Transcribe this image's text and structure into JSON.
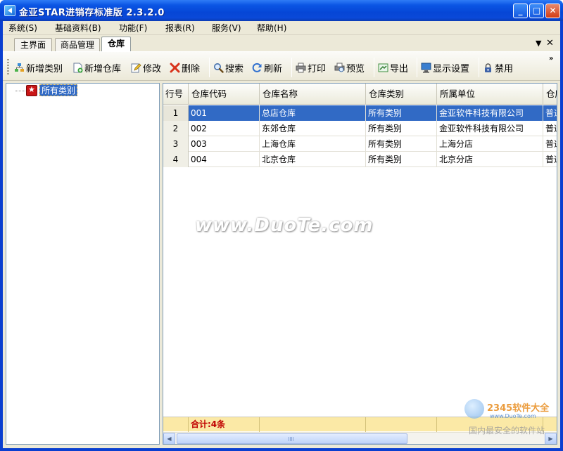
{
  "window": {
    "title": "金亚STAR进销存标准版 2.3.2.0",
    "controls": {
      "minimize": "_",
      "maximize": "□",
      "close": "✕"
    }
  },
  "menu": [
    {
      "label": "系统(S)"
    },
    {
      "label": "基础资料(B)"
    },
    {
      "label": "功能(F)"
    },
    {
      "label": "报表(R)"
    },
    {
      "label": "服务(V)"
    },
    {
      "label": "帮助(H)"
    }
  ],
  "tabs": [
    {
      "label": "主界面",
      "active": false
    },
    {
      "label": "商品管理",
      "active": false
    },
    {
      "label": "仓库",
      "active": true
    }
  ],
  "tab_controls": {
    "dropdown": "▼",
    "close": "✕"
  },
  "toolbar": {
    "add_category": "新增类别",
    "add_warehouse": "新增仓库",
    "edit": "修改",
    "delete": "删除",
    "search": "搜索",
    "refresh": "刷新",
    "print": "打印",
    "preview": "预览",
    "export": "导出",
    "display_settings": "显示设置",
    "disable": "禁用",
    "more": "»"
  },
  "tree": {
    "root_label": "所有类别"
  },
  "grid": {
    "columns": [
      "行号",
      "仓库代码",
      "仓库名称",
      "仓库类别",
      "所属单位",
      "仓库"
    ],
    "rows": [
      {
        "num": "1",
        "code": "001",
        "name": "总店仓库",
        "category": "所有类别",
        "unit": "金亚软件科技有限公司",
        "type": "普通",
        "selected": true
      },
      {
        "num": "2",
        "code": "002",
        "name": "东郊仓库",
        "category": "所有类别",
        "unit": "金亚软件科技有限公司",
        "type": "普通",
        "selected": false
      },
      {
        "num": "3",
        "code": "003",
        "name": "上海仓库",
        "category": "所有类别",
        "unit": "上海分店",
        "type": "普通",
        "selected": false
      },
      {
        "num": "4",
        "code": "004",
        "name": "北京仓库",
        "category": "所有类别",
        "unit": "北京分店",
        "type": "普通",
        "selected": false
      }
    ],
    "footer_total": "合计:4条"
  },
  "watermark": "www.DuoTe.com",
  "corner_logo": {
    "brand": "2345软件大全",
    "url": "www.DuoTe.com",
    "slogan": "国内最安全的软件站"
  },
  "colors": {
    "selection": "#316ac5",
    "titlebar": "#0a55e4",
    "footer_bg": "#fbe9a6",
    "total_text": "#c00000"
  }
}
